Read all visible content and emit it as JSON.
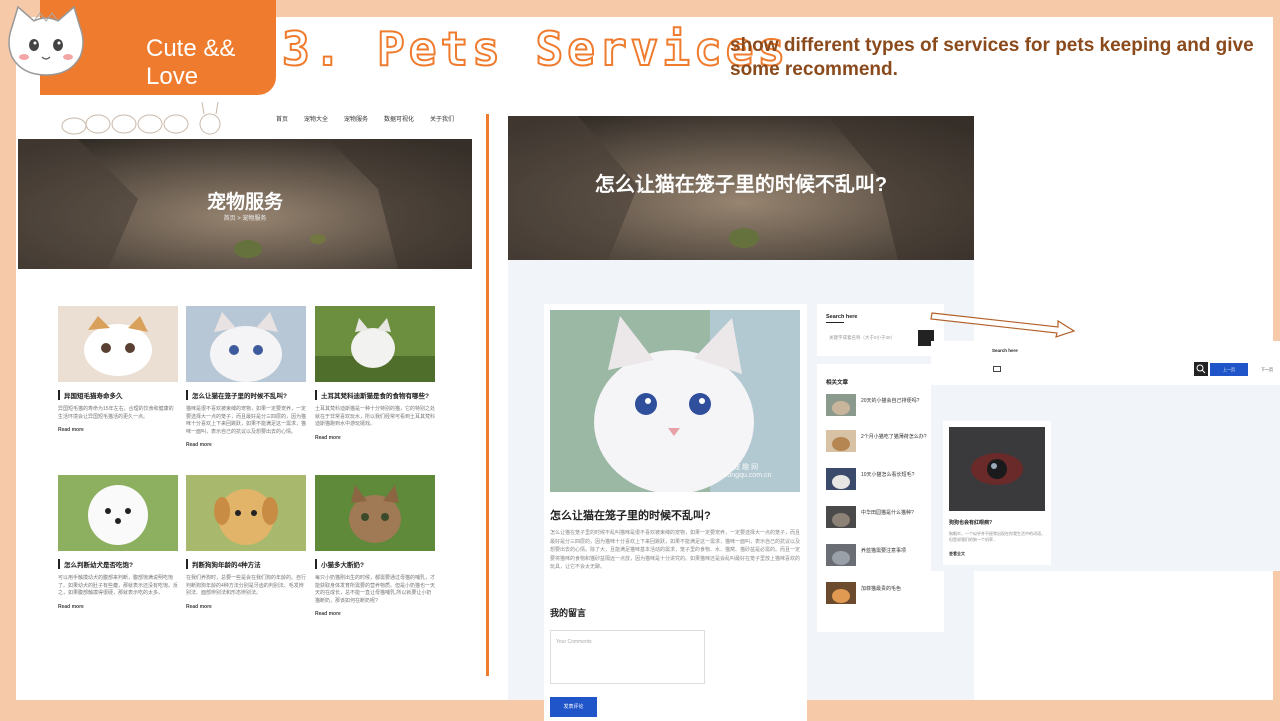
{
  "badge": {
    "text": "Cute && Love"
  },
  "slide": {
    "title": "3. Pets Services",
    "subtitle": "show different types of services for pets keeping and give some recommend."
  },
  "left_page": {
    "nav": [
      "首页",
      "宠物大全",
      "宠物服务",
      "数据可视化",
      "关于我们"
    ],
    "hero_title": "宠物服务",
    "breadcrumb": "首页 > 宠物服务",
    "cards": [
      {
        "title": "异国短毛猫寿命多久",
        "desc": "异国短毛猫的寿命为15年左右，合理的饮食和健康的生活环境会让异国短毛猫活的更久一点。",
        "more": "Read more"
      },
      {
        "title": "怎么让猫在笼子里的时候不乱叫?",
        "desc": "猫咪是很不喜欢被束缚的宠物，如果一定要宠养，一定要选择大一点的笼子，而且最好是分三四层的，因为猫咪十分喜欢上下来回跳跃，如果不能满足这一需求，猫咪一面叫，表示自己的抗议以及想要出去的心情。",
        "more": "Read more"
      },
      {
        "title": "土耳其梵科迪斯猫是食的食物有哪些?",
        "desc": "土耳其梵科迪斯猫是一种十分特别的猫，它的特别之处就在于非常喜欢玩水，所以我们经常可看到土耳其梵科迪斯猫跑到水中游玩嬉戏。",
        "more": "Read more"
      },
      {
        "title": "怎么判断幼犬是否吃饱?",
        "desc": "可以用手触摸幼犬的腹部来判断，腹部饱满说明吃饱了。如果幼犬的肚子有些瘪，那就表示还没有吃饱。反之，如果腹部触摸得很硬，那就表示吃的太多。",
        "more": "Read more"
      },
      {
        "title": "判断狗狗年龄的4种方法",
        "desc": "在我们养狗时，总要一些是会在我们狗的年龄的。自行判断狗狗年龄的4种方法分别是牙齿的判别法、毛发辨别法、面部辨别法和形态辨别法。",
        "more": "Read more"
      },
      {
        "title": "小猫多大断奶?",
        "desc": "每只小奶猫刚出生的时候，都需要通过母猫的哺乳，才能获取身体发育所需要的营养物质。但是小奶猫也一天天的在成长，总不能一直让母猫哺乳,所以就要让小奶猫断奶，那该如何在断奶呢?",
        "more": "Read more"
      }
    ]
  },
  "middle_page": {
    "hero_title": "怎么让猫在笼子里的时候不乱叫?",
    "article_title": "怎么让猫在笼子里的时候不乱叫?",
    "article_body": "怎么让猫在笼子里的时候不乱叫猫咪是很不喜欢被束缚的宠物，如果一定要宠养，一定要选择大一点的笼子，而且最好是分三四层的，因为猫咪十分喜欢上下来回跳跃，如果不能满足这一需求，猫咪一面叫，表示自己的抗议以及想要出去的心情。除了大，且能满足猫咪基本活动的需求，笼子里的食物、水、猫窝、猫砂盆是必需的。而且一定要将猫咪的食物和猫砂盆隔远一点放，因为猫咪是十分讲究的。如果猫咪还是会乱叫最好在笼子里放上猫咪喜欢的玩具，让它不会太无聊。",
    "image_watermark": "宠 趣 网\nchongqu.com.cn",
    "comment_heading": "我的留言",
    "comment_placeholder": "Your Comments",
    "submit_label": "发表评论",
    "search": {
      "title": "Search here",
      "placeholder": "关键字或着名称（大于0小于30）"
    },
    "related": {
      "title": "相关文章",
      "items": [
        "20天的小猫会自己排便吗?",
        "2个月小猫吃了猫薄荷怎么办?",
        "10天小猫怎么看长短毛?",
        "中华田园猫是什么猫种?",
        "养蓝猫需要注意事项",
        "加菲猫最贵的毛色"
      ]
    }
  },
  "right_panel": {
    "search_title": "Search here",
    "prev_label": "上一页",
    "next_label": "下一页",
    "card_title": "狗狗也会有红眼病?",
    "card_desc": "狗眼炎，一个似乎并不经常出现在你我生活中的词语，但是却我们的狗一个机率...",
    "card_more": "查看全文"
  },
  "colors": {
    "accent": "#ef7b2e",
    "background": "#f6c9a9",
    "primary_button": "#1f55c9",
    "subtitle": "#8a4a1c"
  }
}
